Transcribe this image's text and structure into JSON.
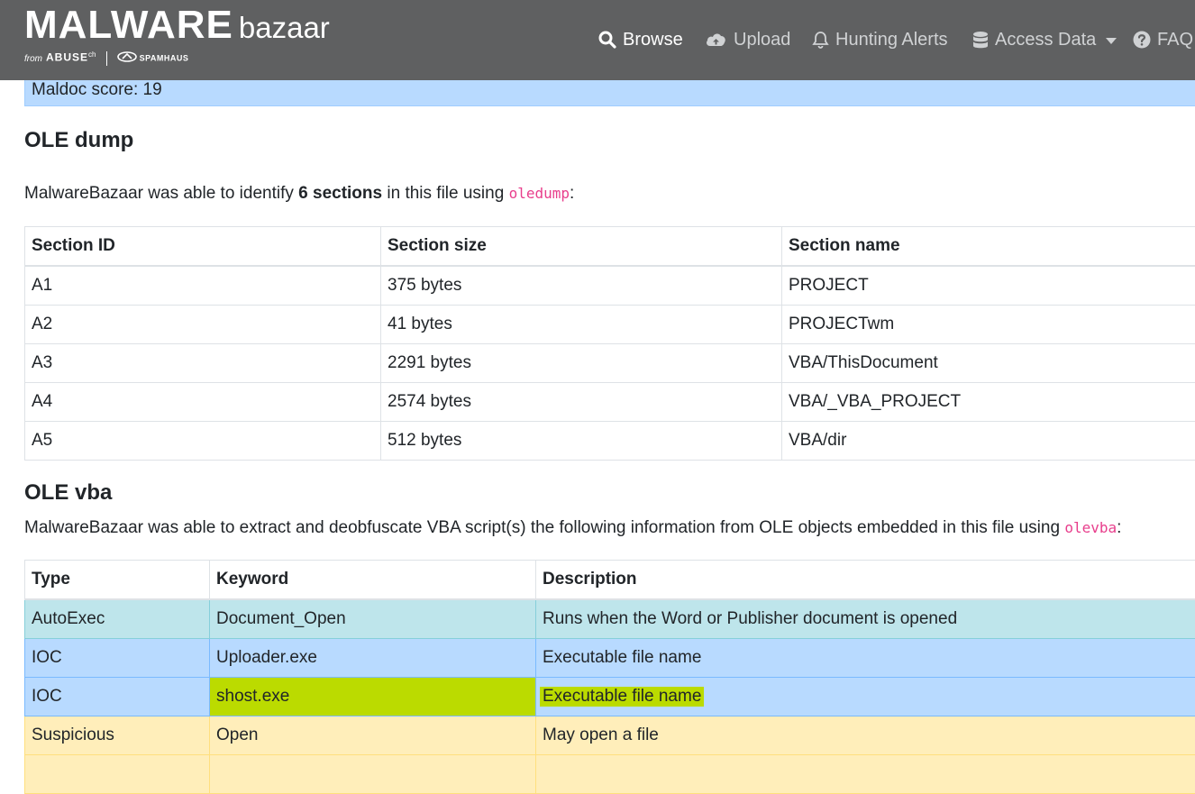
{
  "brand": {
    "main": "MALWARE",
    "sub": "bazaar",
    "from": "from",
    "abuse": "ABUSE",
    "abuse_sup": "ch",
    "spamhaus": "SPAMHAUS"
  },
  "nav": {
    "browse": "Browse",
    "upload": "Upload",
    "hunting": "Hunting Alerts",
    "access": "Access Data",
    "faq": "FAQ"
  },
  "maldoc": {
    "score_text": "Maldoc score: 19"
  },
  "ole_dump": {
    "heading": "OLE dump",
    "intro_prefix": "MalwareBazaar was able to identify ",
    "intro_bold": "6 sections",
    "intro_mid": " in this file using ",
    "intro_tool": "oledump",
    "intro_suffix": ":",
    "headers": [
      "Section ID",
      "Section size",
      "Section name"
    ],
    "rows": [
      [
        "A1",
        "375 bytes",
        "PROJECT"
      ],
      [
        "A2",
        "41 bytes",
        "PROJECTwm"
      ],
      [
        "A3",
        "2291 bytes",
        "VBA/ThisDocument"
      ],
      [
        "A4",
        "2574 bytes",
        "VBA/_VBA_PROJECT"
      ],
      [
        "A5",
        "512 bytes",
        "VBA/dir"
      ]
    ]
  },
  "ole_vba": {
    "heading": "OLE vba",
    "intro_prefix": "MalwareBazaar was able to extract and deobfuscate VBA script(s) the following information from OLE objects embedded in this file using ",
    "intro_tool": "olevba",
    "intro_suffix": ":",
    "headers": [
      "Type",
      "Keyword",
      "Description"
    ],
    "rows": [
      [
        "AutoExec",
        "Document_Open",
        "Runs when the Word or Publisher document is opened"
      ],
      [
        "IOC",
        "Uploader.exe",
        "Executable file name"
      ],
      [
        "IOC",
        "shost.exe",
        "Executable file name"
      ],
      [
        "Suspicious",
        "Open",
        "May open a file"
      ]
    ],
    "highlight_color": "#bbdb00"
  }
}
